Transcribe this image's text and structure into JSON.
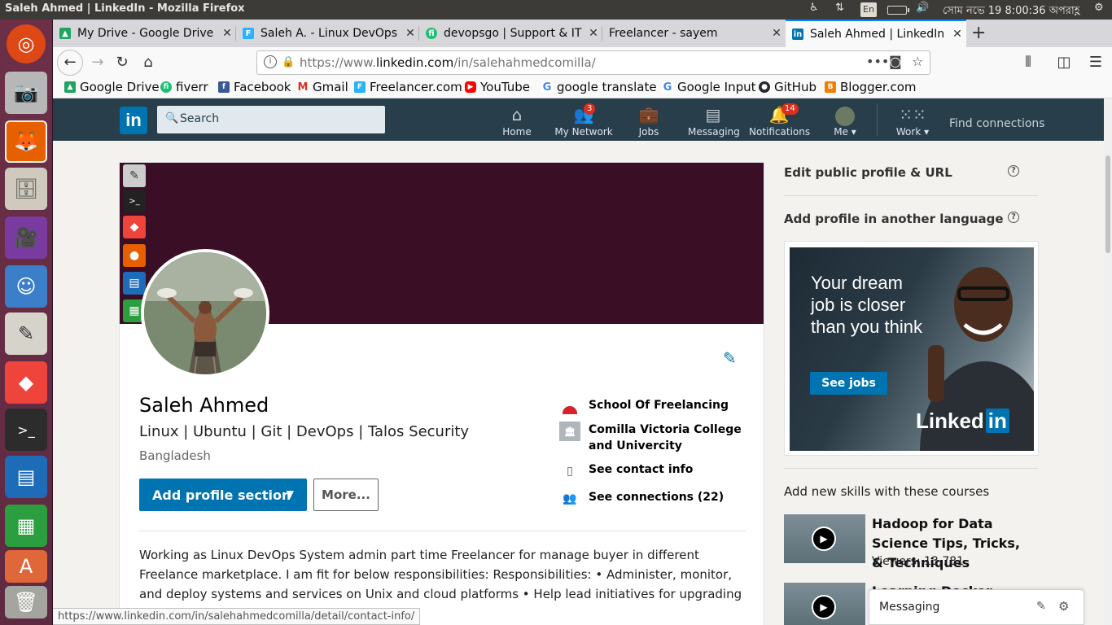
{
  "panel": {
    "window_title": "Saleh Ahmed | LinkedIn - Mozilla Firefox",
    "keyboard": "En",
    "clock": "সোম নভে 19  8:00:36 অপরাহ্ণ"
  },
  "launcher": {
    "items": [
      "ubuntu-dash",
      "screenshot",
      "firefox",
      "files",
      "video",
      "mascot",
      "text-editor",
      "anydesk",
      "terminal",
      "writer",
      "calc",
      "software",
      "trash"
    ]
  },
  "tabs": [
    {
      "label": "My Drive - Google Drive",
      "favicon": "google-drive-icon",
      "color": "#1fa463"
    },
    {
      "label": "Saleh A. - Linux DevOps",
      "favicon": "freelancer-icon",
      "color": "#29b2fe"
    },
    {
      "label": "devopsgo | Support & IT",
      "favicon": "fiverr-icon",
      "color": "#1dbf73"
    },
    {
      "label": "Freelancer - sayem",
      "favicon": "",
      "color": ""
    },
    {
      "label": "Saleh Ahmed | LinkedIn",
      "favicon": "linkedin-icon",
      "color": "#0073b1"
    }
  ],
  "address": {
    "prefix": "https://www.",
    "domain": "linkedin.com",
    "path": "/in/salehahmedcomilla/"
  },
  "bookmarks": [
    {
      "label": "Google Drive",
      "icon": "google-drive-icon",
      "color": "#1fa463"
    },
    {
      "label": "fiverr",
      "icon": "fiverr-icon",
      "color": "#1dbf73"
    },
    {
      "label": "Facebook",
      "icon": "facebook-icon",
      "color": "#3b5998"
    },
    {
      "label": "Gmail",
      "icon": "gmail-icon",
      "color": "#d93025"
    },
    {
      "label": "Freelancer.com",
      "icon": "freelancer-icon",
      "color": "#29b2fe"
    },
    {
      "label": "YouTube",
      "icon": "youtube-icon",
      "color": "#ff0000"
    },
    {
      "label": "google translate",
      "icon": "google-icon",
      "color": "#4285f4"
    },
    {
      "label": "Google Input",
      "icon": "google-icon",
      "color": "#4285f4"
    },
    {
      "label": "GitHub",
      "icon": "github-icon",
      "color": "#24292e"
    },
    {
      "label": "Blogger.com",
      "icon": "blogger-icon",
      "color": "#f57d00"
    }
  ],
  "linkedin": {
    "logo": "in",
    "search_placeholder": "Search",
    "nav": [
      {
        "label": "Home",
        "icon": "home-icon",
        "badge": ""
      },
      {
        "label": "My Network",
        "icon": "network-icon",
        "badge": "3"
      },
      {
        "label": "Jobs",
        "icon": "briefcase-icon",
        "badge": ""
      },
      {
        "label": "Messaging",
        "icon": "messaging-icon",
        "badge": ""
      },
      {
        "label": "Notifications",
        "icon": "bell-icon",
        "badge": "14"
      },
      {
        "label": "Me ▾",
        "icon": "avatar-icon",
        "badge": ""
      },
      {
        "label": "Work ▾",
        "icon": "grid-icon",
        "badge": ""
      }
    ],
    "find_connections": "Find connections",
    "accent": "#0073b1",
    "header_bg": "#283e4a"
  },
  "profile": {
    "name": "Saleh Ahmed",
    "headline": "Linux | Ubuntu | Git | DevOps | Talos Security",
    "location": "Bangladesh",
    "add_section_label": "Add profile section",
    "more_label": "More...",
    "side": [
      {
        "label": "School Of Freelancing",
        "icon": "school-logo-icon"
      },
      {
        "label": "Comilla Victoria College and Univercity",
        "icon": "college-logo-icon"
      },
      {
        "label": "See contact info",
        "icon": "contact-card-icon"
      },
      {
        "label": "See connections (22)",
        "icon": "people-icon"
      }
    ],
    "summary": "Working as Linux DevOps System admin part time Freelancer for manage buyer in different Freelance marketplace. I am fit for below responsibilities: Responsibilities: • Administer, monitor, and deploy systems and services on Unix and cloud platforms • Help lead initiatives for upgrading and scaling our s..."
  },
  "right": {
    "edit_public": "Edit public profile & URL",
    "add_language": "Add profile in another language",
    "ad_text": "Your dream job is closer than you think",
    "ad_button": "See jobs",
    "ad_logo_a": "Linked",
    "ad_logo_b": "in",
    "skills_heading": "Add new skills with these courses",
    "courses": [
      {
        "title": "Hadoop for Data Science Tips, Tricks, & Techniques",
        "views": "Viewers: 13,781"
      },
      {
        "title": "Learning Docker",
        "views": ""
      }
    ]
  },
  "messaging": {
    "label": "Messaging"
  },
  "status_url": "https://www.linkedin.com/in/salehahmedcomilla/detail/contact-info/"
}
